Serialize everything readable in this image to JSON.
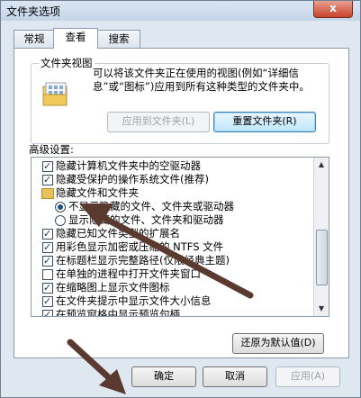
{
  "window": {
    "title": "文件夹选项",
    "close_label": "x"
  },
  "tabs": [
    {
      "label": "常规",
      "active": false
    },
    {
      "label": "查看",
      "active": true
    },
    {
      "label": "搜索",
      "active": false
    }
  ],
  "folder_view": {
    "legend": "文件夹视图",
    "description": "可以将该文件夹正在使用的视图(例如“详细信息”或“图标”)应用到所有这种类型的文件夹中。",
    "apply_label": "应用到文件夹(L)",
    "reset_label": "重置文件夹(R)"
  },
  "advanced": {
    "label": "高级设置:",
    "items": [
      {
        "type": "checkbox",
        "checked": true,
        "label": "隐藏计算机文件夹中的空驱动器"
      },
      {
        "type": "checkbox",
        "checked": true,
        "label": "隐藏受保护的操作系统文件(推荐)"
      },
      {
        "type": "folder",
        "label": "隐藏文件和文件夹"
      },
      {
        "type": "radio",
        "checked": true,
        "label": "不显示隐藏的文件、文件夹或驱动器"
      },
      {
        "type": "radio",
        "checked": false,
        "label": "显示隐藏的文件、文件夹和驱动器"
      },
      {
        "type": "checkbox",
        "checked": true,
        "label": "隐藏已知文件类型的扩展名"
      },
      {
        "type": "checkbox",
        "checked": true,
        "label": "用彩色显示加密或压缩的 NTFS 文件"
      },
      {
        "type": "checkbox",
        "checked": true,
        "label": "在标题栏显示完整路径(仅限经典主题)"
      },
      {
        "type": "checkbox",
        "checked": false,
        "label": "在单独的进程中打开文件夹窗口"
      },
      {
        "type": "checkbox",
        "checked": true,
        "label": "在缩略图上显示文件图标"
      },
      {
        "type": "checkbox",
        "checked": true,
        "label": "在文件夹提示中显示文件大小信息"
      },
      {
        "type": "checkbox",
        "checked": true,
        "label": "在预览窗格中显示预览句柄"
      }
    ],
    "restore_label": "还原为默认值(D)"
  },
  "footer": {
    "ok_label": "确定",
    "cancel_label": "取消",
    "apply_label": "应用(A)"
  },
  "colors": {
    "annotation_arrow": "#5a3a2e"
  }
}
